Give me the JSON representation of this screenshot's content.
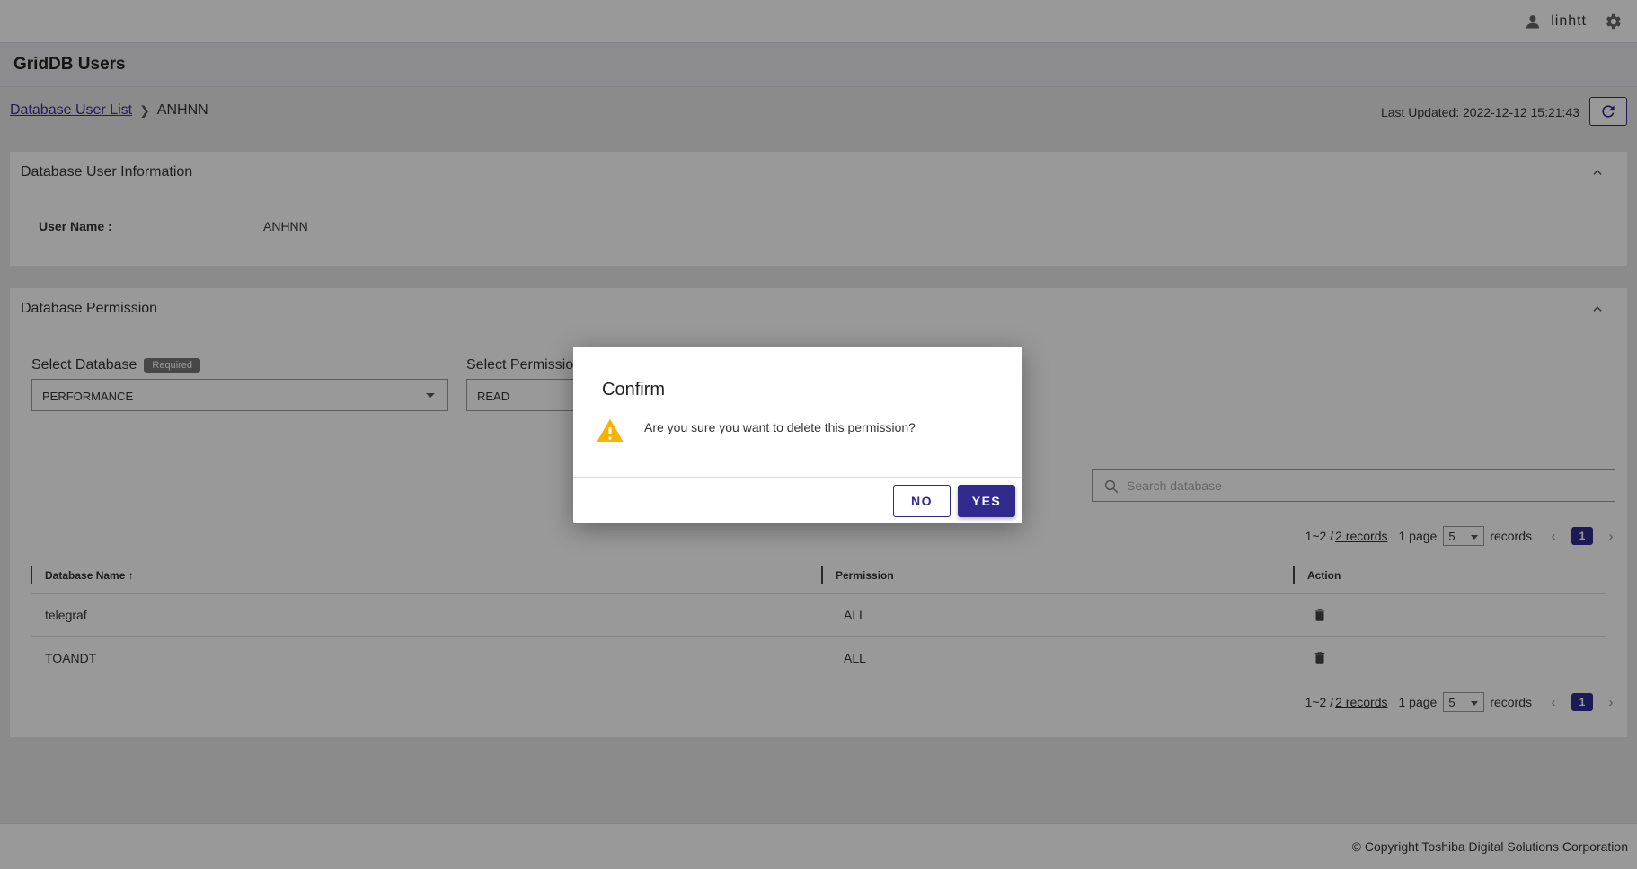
{
  "header": {
    "username": "linhtt",
    "user_icon": "person-icon",
    "settings_icon": "gear-icon"
  },
  "page": {
    "title": "GridDB Users"
  },
  "breadcrumb": {
    "parent": "Database User List",
    "current": "ANHNN"
  },
  "last_updated": "Last Updated: 2022-12-12 15:21:43",
  "user_info": {
    "title": "Database User Information",
    "user_name_label": "User Name :",
    "user_name_value": "ANHNN"
  },
  "permission": {
    "title": "Database Permission",
    "select_database_label": "Select Database",
    "required_badge": "Required",
    "select_database_value": "PERFORMANCE",
    "select_permission_label": "Select Permission",
    "select_permission_value": "READ",
    "search_placeholder": "Search database",
    "pager": {
      "range": "1~2 /",
      "records_link": "2 records",
      "pages": "1 page",
      "page_size": "5",
      "records_label": "records",
      "current_page": "1"
    },
    "columns": [
      "Database Name",
      "Permission",
      "Action"
    ],
    "rows": [
      {
        "name": "telegraf",
        "permission": "ALL"
      },
      {
        "name": "TOANDT",
        "permission": "ALL"
      }
    ]
  },
  "footer": {
    "copyright": "© Copyright Toshiba Digital Solutions Corporation"
  },
  "dialog": {
    "title": "Confirm",
    "message": "Are you sure you want to delete this permission?",
    "no_label": "NO",
    "yes_label": "YES"
  },
  "colors": {
    "accent": "#2f2a8c",
    "warning": "#f5b400"
  }
}
